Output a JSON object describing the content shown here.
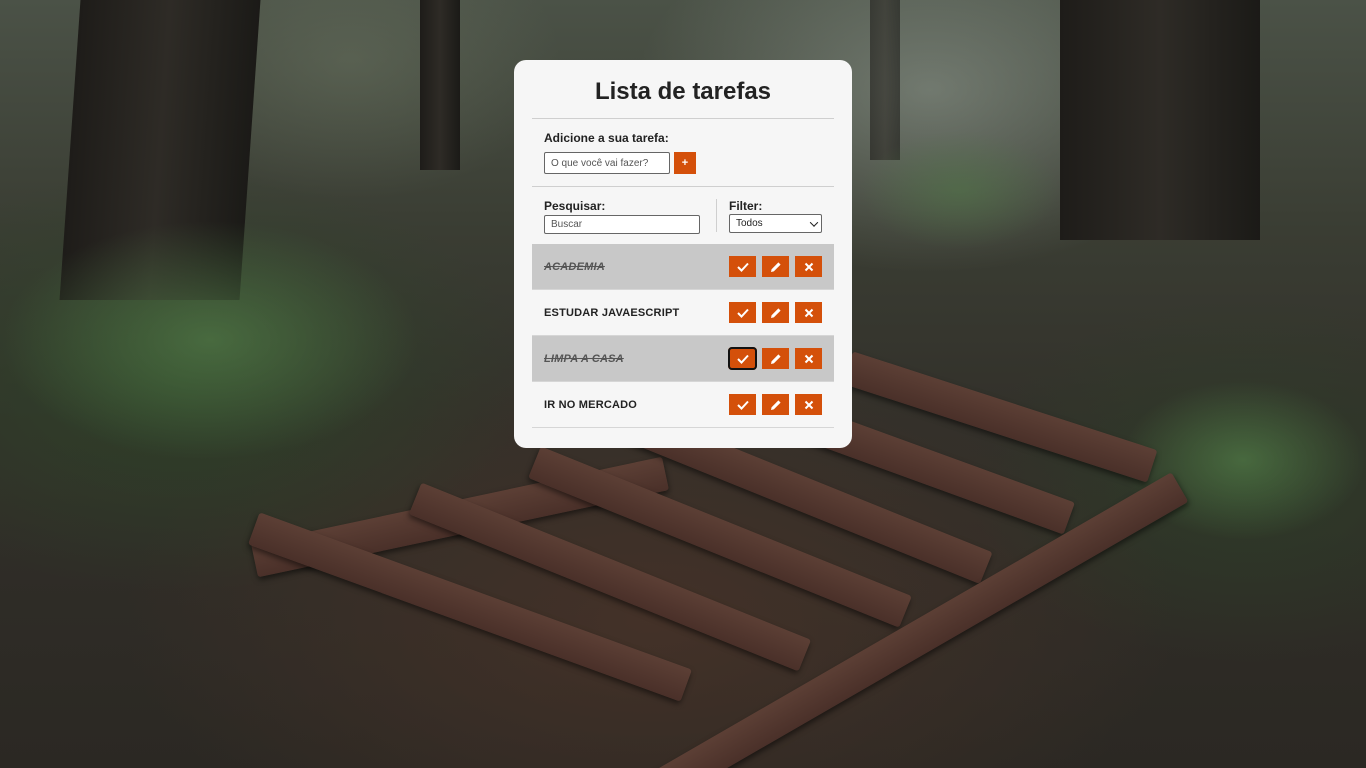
{
  "app": {
    "title": "Lista de tarefas"
  },
  "add": {
    "label": "Adicione a sua tarefa:",
    "placeholder": "O que você vai fazer?",
    "value": "",
    "button_label": "+"
  },
  "search": {
    "label": "Pesquisar:",
    "placeholder": "Buscar",
    "value": ""
  },
  "filter": {
    "label": "Filter:",
    "selected": "Todos"
  },
  "todos": [
    {
      "title": "ACADEMIA",
      "done": true
    },
    {
      "title": "ESTUDAR JAVAESCRIPT",
      "done": false
    },
    {
      "title": "LIMPA A CASA",
      "done": true
    },
    {
      "title": "IR NO MERCADO",
      "done": false
    }
  ],
  "icons": {
    "complete": "check-icon",
    "edit": "pencil-icon",
    "remove": "close-icon"
  },
  "colors": {
    "accent": "#d4500a",
    "card": "#f6f6f6",
    "done_row": "#c8c8c8"
  }
}
